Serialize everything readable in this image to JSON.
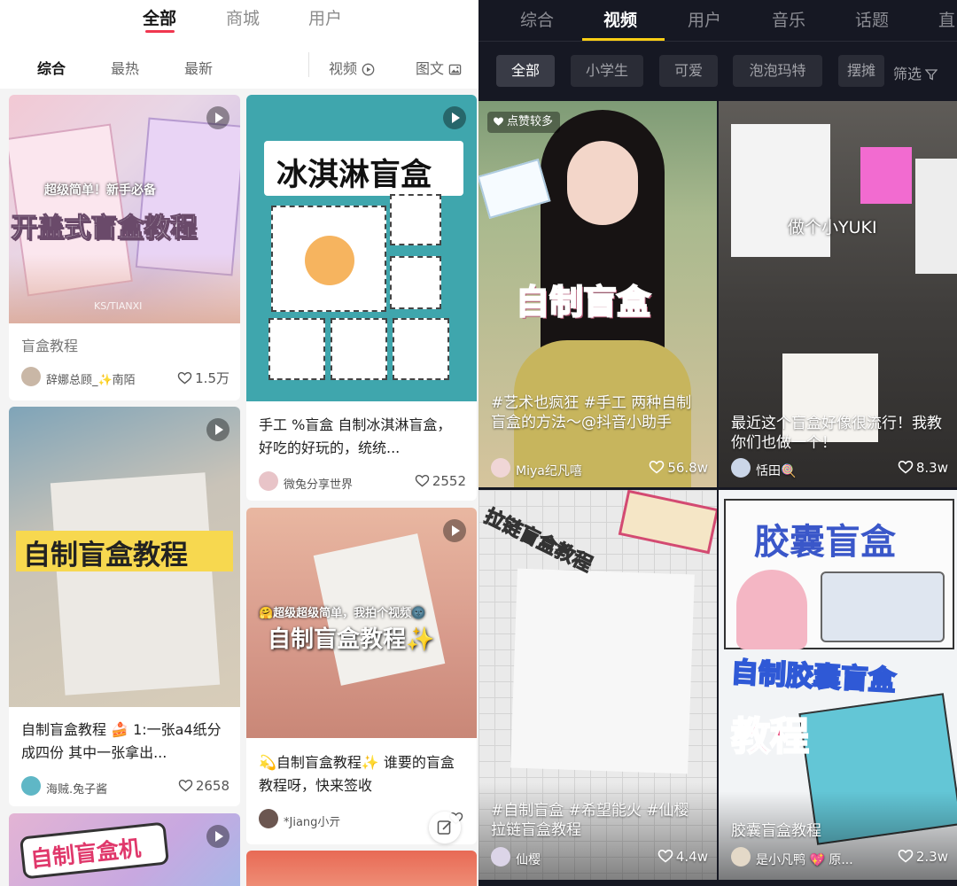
{
  "left": {
    "tabs": [
      "全部",
      "商城",
      "用户"
    ],
    "filters": {
      "sort": [
        "综合",
        "最热",
        "最新"
      ],
      "video": "视频",
      "image_text": "图文"
    },
    "cards": [
      {
        "overlay": "开盖式盲盒教程",
        "overlay_small": "超级简单！新手必备",
        "watermark": "KS/TIANXI",
        "title": "盲盒教程",
        "author": "辞娜总顾_✨南陌",
        "likes": "1.5万"
      },
      {
        "overlay": "冰淇淋盲盒",
        "title": "手工 %盲盒 自制冰淇淋盲盒，好吃的好玩的，统统...",
        "author": "微兔分享世界",
        "likes": "2552"
      },
      {
        "overlay": "自制盲盒教程",
        "title": "自制盲盒教程 🍰 1:一张a4纸分成四份 其中一张拿出...",
        "author": "海贼.兔子酱",
        "likes": "2658"
      },
      {
        "overlay": "自制盲盒教程✨",
        "overlay_small": "🤗超级超级简单，我拍个视频🌚",
        "title": "💫自制盲盒教程✨ 谁要的盲盒教程呀，快来签收",
        "author": "*Jiang小亓",
        "likes": ""
      },
      {
        "overlay": "自制盲盒机"
      }
    ]
  },
  "right": {
    "tabs": [
      "综合",
      "视频",
      "用户",
      "音乐",
      "话题",
      "直"
    ],
    "chips": [
      "全部",
      "小学生",
      "可爱",
      "泡泡玛特",
      "摆摊"
    ],
    "filter_label": "筛选",
    "badge": "点赞较多",
    "cards": [
      {
        "overlay": "自制盲盒",
        "caption": "#艺术也疯狂 #手工 两种自制盲盒的方法～@抖音小助手",
        "author": "Miya纪凡嘻",
        "likes": "56.8w"
      },
      {
        "overlay": "做个小YUKI",
        "caption": "最近这个盲盒好像很流行！我教你们也做一个！",
        "author": "恬田🍭",
        "likes": "8.3w"
      },
      {
        "overlay": "拉链盲盒教程",
        "caption": "#自制盲盒 #希望能火 #仙樱 拉链盲盒教程",
        "author": "仙樱",
        "likes": "4.4w"
      },
      {
        "overlay": "胶囊盲盒",
        "overlay2": "自制胶囊盲盒",
        "overlay3": "教程",
        "caption": "胶囊盲盒教程",
        "author": "是小凡鸭 💖 原...",
        "likes": "2.3w"
      }
    ]
  },
  "colors": {
    "accent_red": "#f0364f",
    "accent_yellow": "#face15",
    "dark_bg": "#161823"
  }
}
